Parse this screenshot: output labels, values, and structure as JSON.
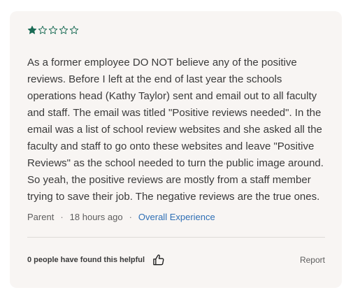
{
  "review": {
    "rating": 1,
    "max_rating": 5,
    "star_color": "#1a6b55",
    "text": "As a former employee DO NOT believe any of the positive reviews. Before I left at the end of last year the schools operations head (Kathy Taylor) sent and email out to all faculty and staff. The email was titled \"Positive reviews needed\". In the email was a list of school review websites and she asked all the faculty and staff to go onto these websites and leave \"Positive Reviews\" as the school needed to turn the public image around. So yeah, the positive reviews are mostly from a staff member trying to save their job. The negative reviews are the true ones.",
    "reviewer_role": "Parent",
    "separator": "·",
    "time_ago": "18 hours ago",
    "topic": "Overall Experience"
  },
  "footer": {
    "helpful_text": "0 people have found this helpful",
    "thumb_icon": "thumbs-up-icon",
    "report_label": "Report"
  }
}
